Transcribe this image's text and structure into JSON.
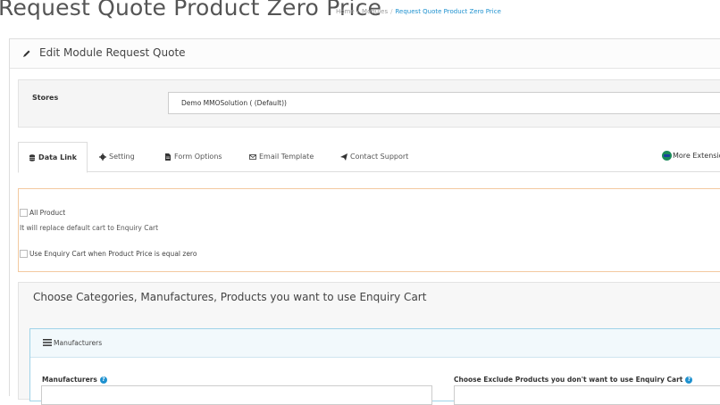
{
  "page": {
    "title": "Request Quote Product Zero Price",
    "breadcrumb": [
      "Home",
      "Modules",
      "Request Quote Product Zero Price"
    ]
  },
  "panel": {
    "title": "Edit Module Request Quote",
    "icon": "pencil-icon"
  },
  "stores": {
    "label": "Stores",
    "selected": "Demo MMOSolution ( (Default))"
  },
  "tabs": [
    {
      "label": "Data Link",
      "icon": "database-icon",
      "active": true
    },
    {
      "label": "Setting",
      "icon": "gear-icon"
    },
    {
      "label": "Form Options",
      "icon": "file-icon"
    },
    {
      "label": "Email Template",
      "icon": "envelope-icon"
    },
    {
      "label": "Contact Support",
      "icon": "paper-plane-icon"
    }
  ],
  "more_extensions": "More Extension",
  "options": {
    "all_product": "All Product",
    "all_product_help": "It will replace default cart to Enquiry Cart",
    "zero_price": "Use Enquiry Cart when Product Price is equal zero"
  },
  "choose": {
    "title": "Choose Categories, Manufactures, Products you want to use Enquiry Cart",
    "section_heading": "Manufacturers",
    "manufacturers_label": "Manufacturers",
    "exclude_label": "Choose Exclude Products you don't want to use Enquiry Cart"
  },
  "colors": {
    "accent": "#1e91cf",
    "warning_border": "#f3c9a0",
    "info_border": "#9fd3e8"
  }
}
